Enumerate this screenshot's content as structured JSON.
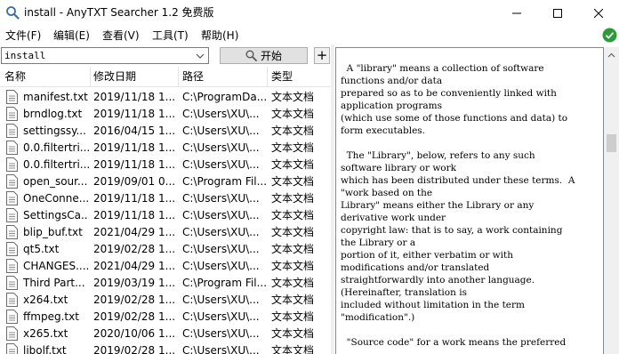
{
  "window": {
    "title": "install - AnyTXT Searcher 1.2 免费版",
    "icon": "search-app-icon"
  },
  "menu": {
    "items": [
      "文件(F)",
      "编辑(E)",
      "查看(V)",
      "工具(T)",
      "帮助(H)"
    ]
  },
  "status": {
    "icon": "check-circle-icon",
    "color": "#2e9a3a"
  },
  "toolbar": {
    "search_value": "install",
    "start_label": "开始",
    "add_label": "+"
  },
  "list": {
    "columns": [
      "名称",
      "修改日期",
      "路径",
      "类型"
    ],
    "rows": [
      {
        "name": "manifest.txt",
        "date": "2019/11/18",
        "time": "1...",
        "path": "C:\\ProgramDa...",
        "type": "文本文档"
      },
      {
        "name": "brndlog.txt",
        "date": "2019/11/18",
        "time": "1...",
        "path": "C:\\Users\\XU\\...",
        "type": "文本文档"
      },
      {
        "name": "settingssy...",
        "date": "2016/04/15",
        "time": "1...",
        "path": "C:\\Users\\XU\\...",
        "type": "文本文档"
      },
      {
        "name": "0.0.filtertri...",
        "date": "2019/11/18",
        "time": "1...",
        "path": "C:\\Users\\XU\\...",
        "type": "文本文档"
      },
      {
        "name": "0.0.filtertri...",
        "date": "2019/11/18",
        "time": "1...",
        "path": "C:\\Users\\XU\\...",
        "type": "文本文档"
      },
      {
        "name": "open_sour...",
        "date": "2019/09/01",
        "time": "0...",
        "path": "C:\\Program Fil...",
        "type": "文本文档"
      },
      {
        "name": "OneConne...",
        "date": "2019/11/18",
        "time": "1...",
        "path": "C:\\Users\\XU\\...",
        "type": "文本文档"
      },
      {
        "name": "SettingsCa...",
        "date": "2019/11/18",
        "time": "1...",
        "path": "C:\\Users\\XU\\...",
        "type": "文本文档"
      },
      {
        "name": "blip_buf.txt",
        "date": "2021/04/29",
        "time": "1...",
        "path": "C:\\Users\\XU\\...",
        "type": "文本文档"
      },
      {
        "name": "qt5.txt",
        "date": "2019/02/28",
        "time": "1...",
        "path": "C:\\Users\\XU\\...",
        "type": "文本文档"
      },
      {
        "name": "CHANGES....",
        "date": "2021/04/29",
        "time": "1...",
        "path": "C:\\Users\\XU\\...",
        "type": "文本文档"
      },
      {
        "name": "Third Part...",
        "date": "2019/03/19",
        "time": "1...",
        "path": "C:\\Program Fil...",
        "type": "文本文档"
      },
      {
        "name": "x264.txt",
        "date": "2019/02/28",
        "time": "1...",
        "path": "C:\\Users\\XU\\...",
        "type": "文本文档"
      },
      {
        "name": "ffmpeg.txt",
        "date": "2019/02/28",
        "time": "1...",
        "path": "C:\\Users\\XU\\...",
        "type": "文本文档"
      },
      {
        "name": "x265.txt",
        "date": "2020/10/06",
        "time": "1...",
        "path": "C:\\Users\\XU\\...",
        "type": "文本文档"
      },
      {
        "name": "libolf.txt",
        "date": "2019/02/28",
        "time": "1...",
        "path": "C:\\Users\\XU\\...",
        "type": "文本文档"
      }
    ]
  },
  "preview": {
    "text": "  A \"library\" means a collection of software\nfunctions and/or data\nprepared so as to be conveniently linked with\napplication programs\n(which use some of those functions and data) to\nform executables.\n\n  The \"Library\", below, refers to any such\nsoftware library or work\nwhich has been distributed under these terms.  A\n\"work based on the\nLibrary\" means either the Library or any\nderivative work under\ncopyright law: that is to say, a work containing\nthe Library or a\nportion of it, either verbatim or with\nmodifications and/or translated\nstraightforwardly into another language.\n(Hereinafter, translation is\nincluded without limitation in the term\n\"modification\".)\n\n  \"Source code\" for a work means the preferred"
  }
}
